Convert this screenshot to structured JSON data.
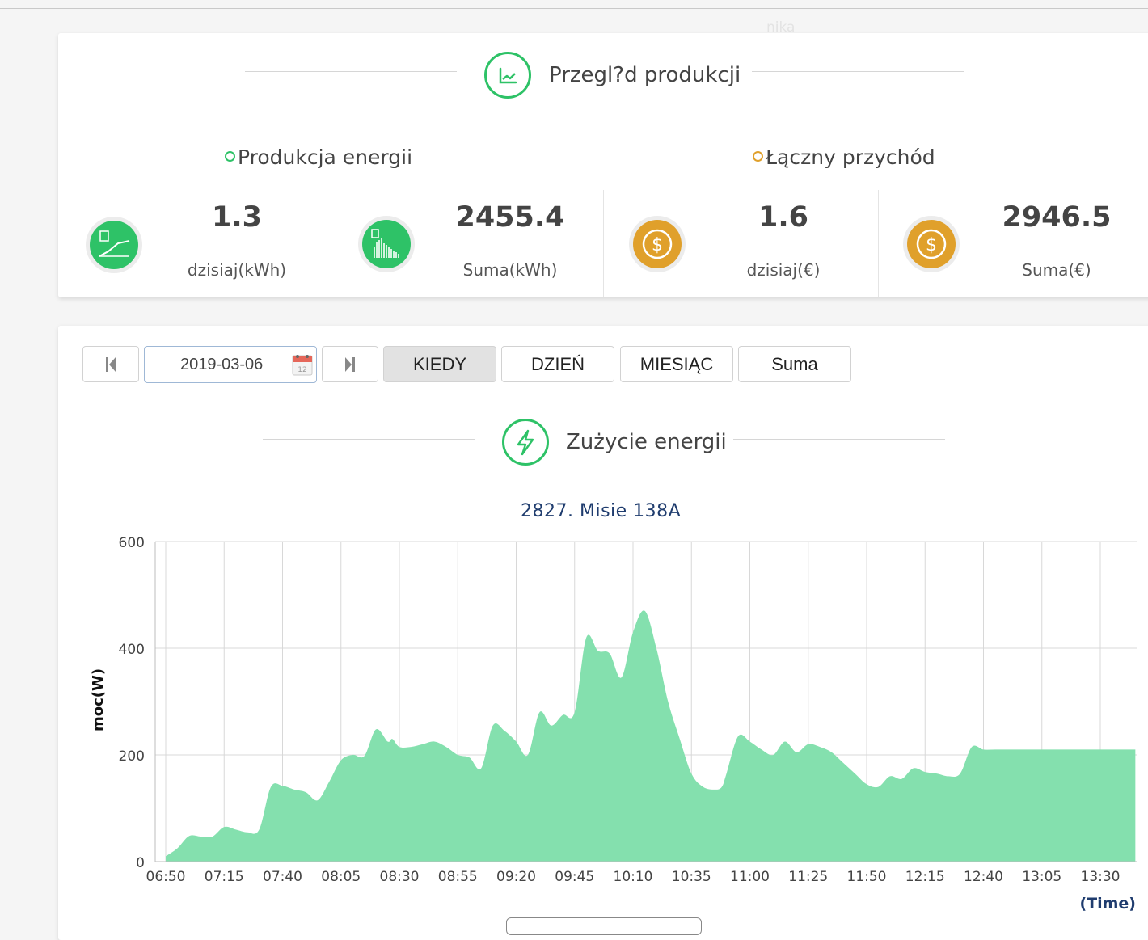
{
  "header": {
    "ghost_text": "nika"
  },
  "overview": {
    "title": "Przegl?d produkcji",
    "energy_heading": "Produkcja energii",
    "revenue_heading": "Łączny przychód",
    "stats": [
      {
        "value": "1.3",
        "label": "dzisiaj(kWh)",
        "icon": "energy-today-icon"
      },
      {
        "value": "2455.4",
        "label": "Suma(kWh)",
        "icon": "energy-total-icon"
      },
      {
        "value": "1.6",
        "label": "dzisiaj(€)",
        "icon": "coin-icon"
      },
      {
        "value": "2946.5",
        "label": "Suma(€)",
        "icon": "coin-icon"
      }
    ]
  },
  "controls": {
    "date": "2019-03-06",
    "prev_icon": "skip-back-icon",
    "next_icon": "skip-forward-icon",
    "calendar_icon": "calendar-icon",
    "tabs": [
      "KIEDY",
      "DZIEŃ",
      "MIESIĄC",
      "Suma"
    ],
    "active_tab": "KIEDY"
  },
  "consumption": {
    "title": "Zużycie energii",
    "icon": "lightning-icon"
  },
  "colors": {
    "green": "#2ec267",
    "gold": "#e0a02b",
    "area": "#84e0ae",
    "title_blue": "#1f3c6e"
  },
  "chart_data": {
    "type": "area",
    "title": "2827. Misie 138A",
    "xlabel": "(Time)",
    "ylabel": "moc(W)",
    "ylim": [
      0,
      600
    ],
    "yticks": [
      0,
      200,
      400,
      600
    ],
    "xticks": [
      "06:50",
      "07:15",
      "07:40",
      "08:05",
      "08:30",
      "08:55",
      "09:20",
      "09:45",
      "10:10",
      "10:35",
      "11:00",
      "11:25",
      "11:50",
      "12:15",
      "12:40",
      "13:05",
      "13:30"
    ],
    "xlim_minutes_from_start": [
      0,
      415
    ],
    "grid": true,
    "legend": "none",
    "series": [
      {
        "color": "#84e0ae",
        "x": [
          0,
          5,
          10,
          15,
          20,
          25,
          30,
          35,
          40,
          45,
          50,
          55,
          60,
          65,
          70,
          75,
          80,
          85,
          90,
          95,
          97,
          100,
          105,
          110,
          115,
          120,
          125,
          130,
          135,
          140,
          145,
          150,
          155,
          160,
          165,
          170,
          175,
          180,
          185,
          190,
          195,
          200,
          205,
          210,
          215,
          220,
          225,
          230,
          235,
          238,
          240,
          245,
          250,
          255,
          260,
          265,
          270,
          275,
          280,
          285,
          290,
          295,
          300,
          305,
          310,
          315,
          320,
          325,
          330,
          335,
          340,
          345,
          350,
          355,
          360,
          365,
          370,
          375,
          380,
          385,
          390,
          395,
          400,
          405,
          410,
          415
        ],
        "y": [
          10,
          25,
          48,
          47,
          47,
          65,
          60,
          55,
          60,
          140,
          142,
          135,
          130,
          115,
          150,
          190,
          200,
          198,
          248,
          225,
          230,
          215,
          215,
          220,
          225,
          215,
          200,
          195,
          175,
          255,
          245,
          225,
          200,
          280,
          255,
          275,
          280,
          420,
          395,
          390,
          345,
          430,
          470,
          400,
          300,
          230,
          165,
          140,
          135,
          140,
          165,
          235,
          225,
          210,
          200,
          225,
          205,
          220,
          215,
          205,
          185,
          165,
          145,
          140,
          160,
          155,
          175,
          168,
          165,
          160,
          165,
          215,
          210,
          210,
          210,
          210,
          210,
          210,
          210,
          210,
          210,
          210,
          210,
          210,
          210,
          210
        ]
      }
    ]
  }
}
